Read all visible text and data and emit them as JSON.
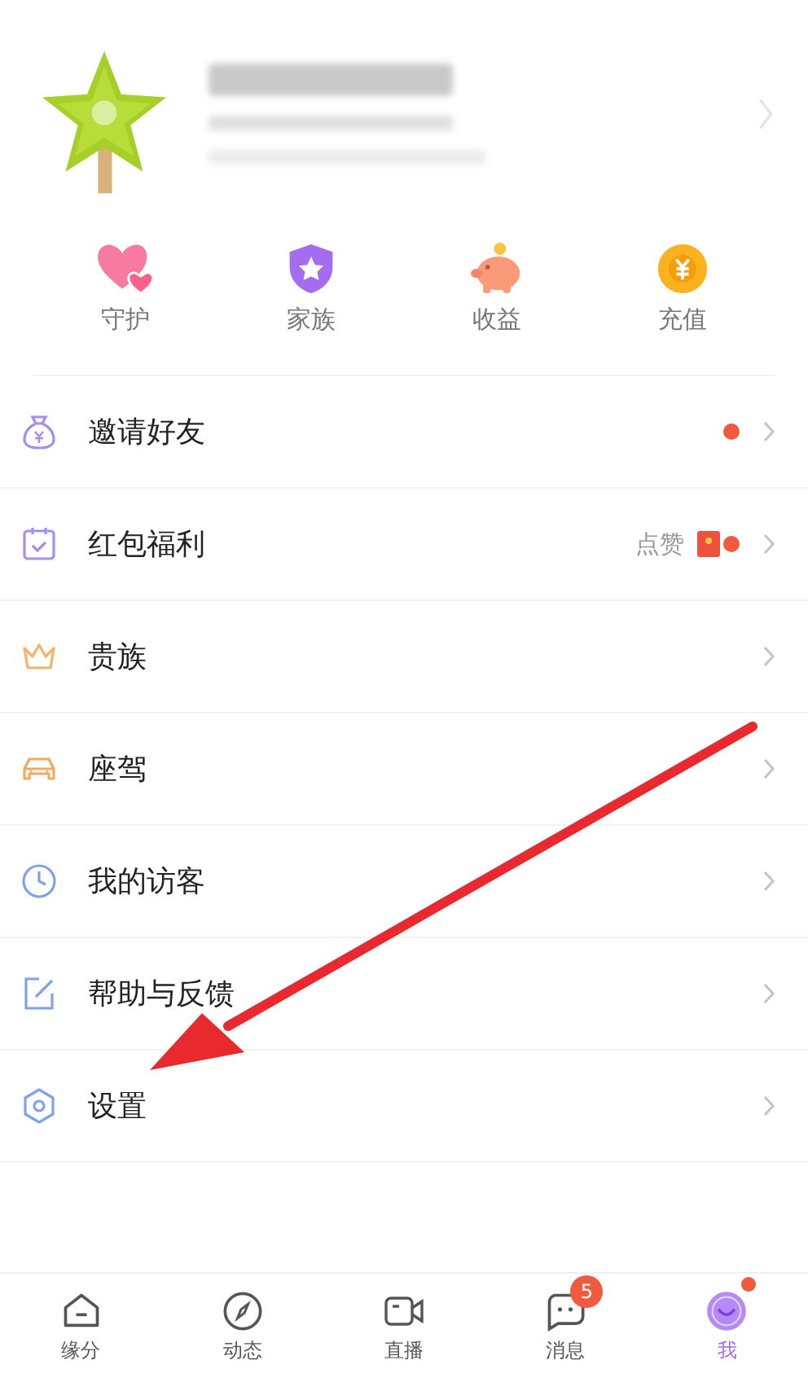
{
  "shortcuts": [
    {
      "kind": "hearts",
      "label": "守护"
    },
    {
      "kind": "shield",
      "label": "家族"
    },
    {
      "kind": "piggy",
      "label": "收益"
    },
    {
      "kind": "coin",
      "label": "充值"
    }
  ],
  "menu": [
    {
      "kind": "bag",
      "label": "邀请好友",
      "dot": true
    },
    {
      "kind": "calendar",
      "label": "红包福利",
      "hint": "点赞",
      "red_packet": true,
      "dot": true
    },
    {
      "kind": "crown",
      "label": "贵族",
      "dot": false
    },
    {
      "kind": "car",
      "label": "座驾",
      "dot": false
    },
    {
      "kind": "clock",
      "label": "我的访客",
      "dot": false
    },
    {
      "kind": "edit",
      "label": "帮助与反馈",
      "dot": false
    },
    {
      "kind": "gear",
      "label": "设置",
      "dot": false
    }
  ],
  "annotation": {
    "kind": "arrow"
  },
  "tabbar": [
    {
      "kind": "home",
      "label": "缘分",
      "selected": false
    },
    {
      "kind": "compass",
      "label": "动态",
      "selected": false
    },
    {
      "kind": "camera",
      "label": "直播",
      "selected": false
    },
    {
      "kind": "chat",
      "label": "消息",
      "selected": false,
      "badge": "5"
    },
    {
      "kind": "face",
      "label": "我",
      "selected": true,
      "dot": true
    }
  ]
}
